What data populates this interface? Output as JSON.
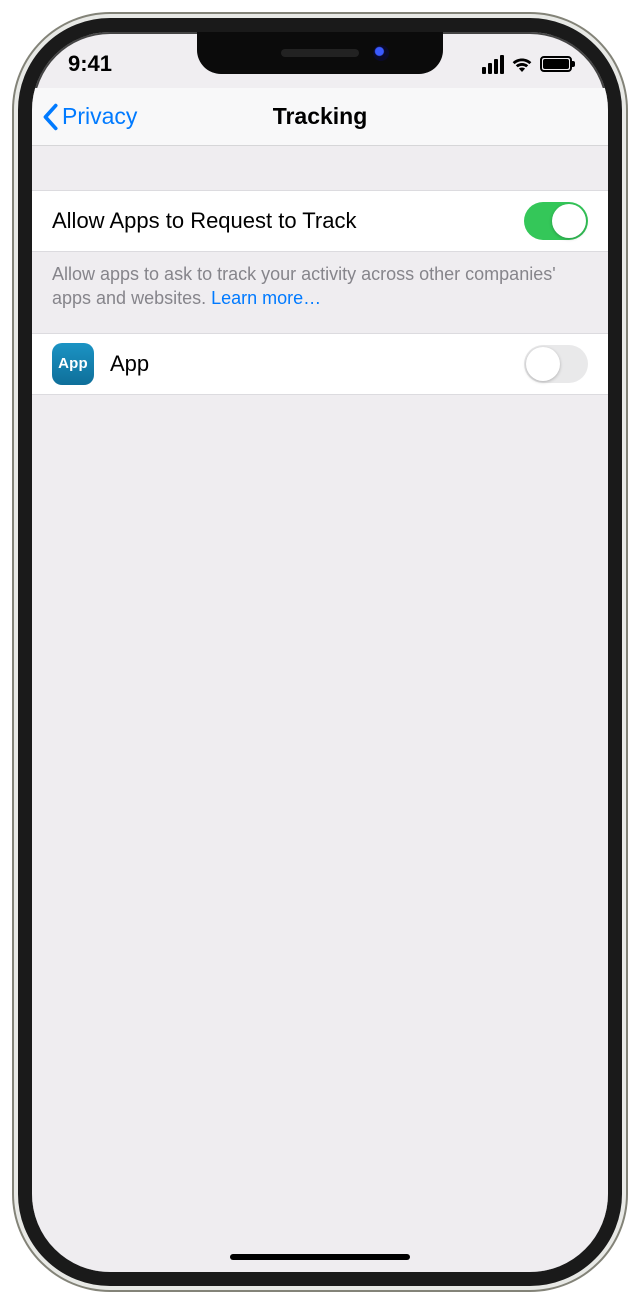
{
  "status": {
    "time": "9:41"
  },
  "nav": {
    "back_label": "Privacy",
    "title": "Tracking"
  },
  "main_toggle": {
    "label": "Allow Apps to Request to Track",
    "on": true
  },
  "description": {
    "text": "Allow apps to ask to track your activity across other companies' apps and websites. ",
    "learn_more": "Learn more…"
  },
  "apps": [
    {
      "icon_label": "App",
      "name": "App",
      "on": false
    }
  ]
}
